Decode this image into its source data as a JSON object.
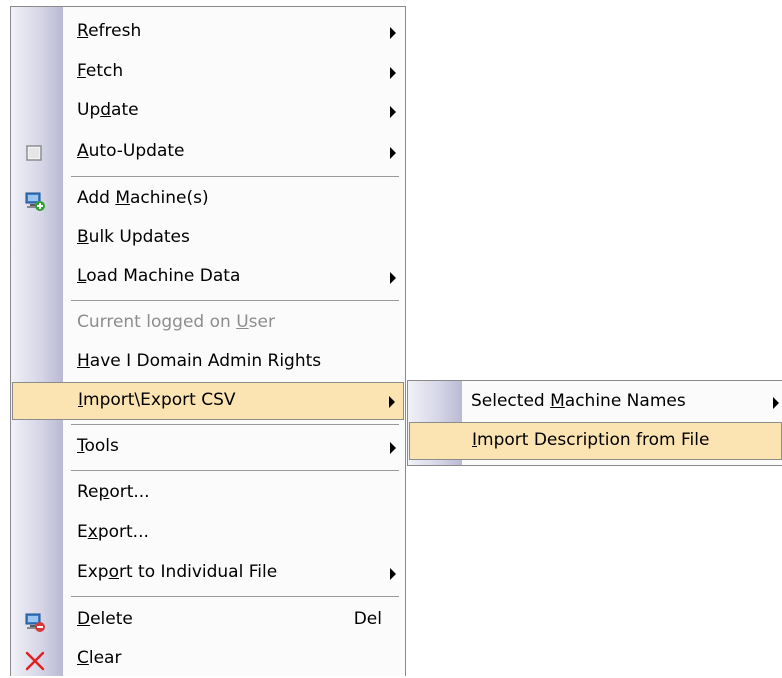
{
  "main_menu": {
    "items": [
      {
        "pre": "",
        "ul": "R",
        "post": "efresh",
        "submenu": true
      },
      {
        "pre": "",
        "ul": "F",
        "post": "etch",
        "submenu": true
      },
      {
        "pre": "Up",
        "ul": "d",
        "post": "ate",
        "submenu": true
      },
      {
        "pre": "",
        "ul": "A",
        "post": "uto-Update",
        "submenu": true,
        "icon": "checkbox-icon"
      },
      {
        "pre": "Add ",
        "ul": "M",
        "post": "achine(s)",
        "icon": "add-machine-icon"
      },
      {
        "pre": "",
        "ul": "B",
        "post": "ulk Updates"
      },
      {
        "pre": "",
        "ul": "L",
        "post": "oad Machine Data",
        "submenu": true
      },
      {
        "pre": "Current logged on ",
        "ul": "U",
        "post": "ser",
        "disabled": true
      },
      {
        "pre": "",
        "ul": "H",
        "post": "ave I Domain Admin Rights"
      },
      {
        "pre": "",
        "ul": "I",
        "post": "mport\\Export CSV",
        "submenu": true,
        "highlighted": true
      },
      {
        "pre": "",
        "ul": "T",
        "post": "ools",
        "submenu": true
      },
      {
        "pre": "Re",
        "ul": "p",
        "post": "ort..."
      },
      {
        "pre": "E",
        "ul": "x",
        "post": "port..."
      },
      {
        "pre": "Exp",
        "ul": "o",
        "post": "rt to Individual File",
        "submenu": true
      },
      {
        "pre": "",
        "ul": "D",
        "post": "elete",
        "shortcut": "Del",
        "icon": "delete-machine-icon"
      },
      {
        "pre": "",
        "ul": "C",
        "post": "lear",
        "icon": "clear-x-icon"
      }
    ]
  },
  "sub_menu": {
    "items": [
      {
        "pre": "Selected ",
        "ul": "M",
        "post": "achine Names",
        "submenu": true
      },
      {
        "pre": "",
        "ul": "I",
        "post": "mport Description from File",
        "highlighted": true
      }
    ]
  },
  "colors": {
    "highlight": "#fbe3b2",
    "gutter": "#b9b9d3",
    "disabled_text": "#8d8d8d",
    "clear_icon": "#e02020"
  }
}
